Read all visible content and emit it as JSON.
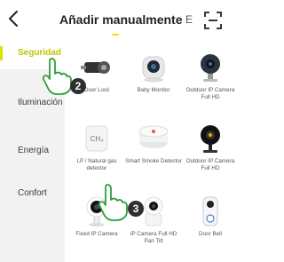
{
  "header": {
    "title": "Añadir manualmente",
    "next_tab_partial": "E"
  },
  "sidebar": {
    "items": [
      {
        "label": "Seguridad",
        "active": true
      },
      {
        "label": "Iluminación",
        "active": false
      },
      {
        "label": "Energía",
        "active": false
      },
      {
        "label": "Confort",
        "active": false
      }
    ]
  },
  "devices": [
    {
      "label": "Door Lock",
      "icon": "door-lock-icon"
    },
    {
      "label": "Baby Monitor",
      "icon": "baby-monitor-icon"
    },
    {
      "label": "Outdoor IP Camera Full HD",
      "icon": "outdoor-camera-icon"
    },
    {
      "label": "LP / Natural gas detector",
      "icon": "gas-detector-icon",
      "icon_text": "CH₄"
    },
    {
      "label": "Smart Smoke Detector",
      "icon": "smoke-detector-icon"
    },
    {
      "label": "Outdoor IP Camera Full HD",
      "icon": "outdoor-camera-2-icon"
    },
    {
      "label": "Fixed IP Camera",
      "icon": "fixed-camera-icon"
    },
    {
      "label": "IP Camera Full HD Pan Tilt",
      "icon": "pan-tilt-camera-icon"
    },
    {
      "label": "Door Bell",
      "icon": "door-bell-icon"
    }
  ],
  "annotations": {
    "step_2": "2",
    "step_3": "3"
  },
  "colors": {
    "accent": "#c8d400",
    "sidebar_bg": "#f2f2f2",
    "annotation_hand": "#2e9e3c"
  }
}
